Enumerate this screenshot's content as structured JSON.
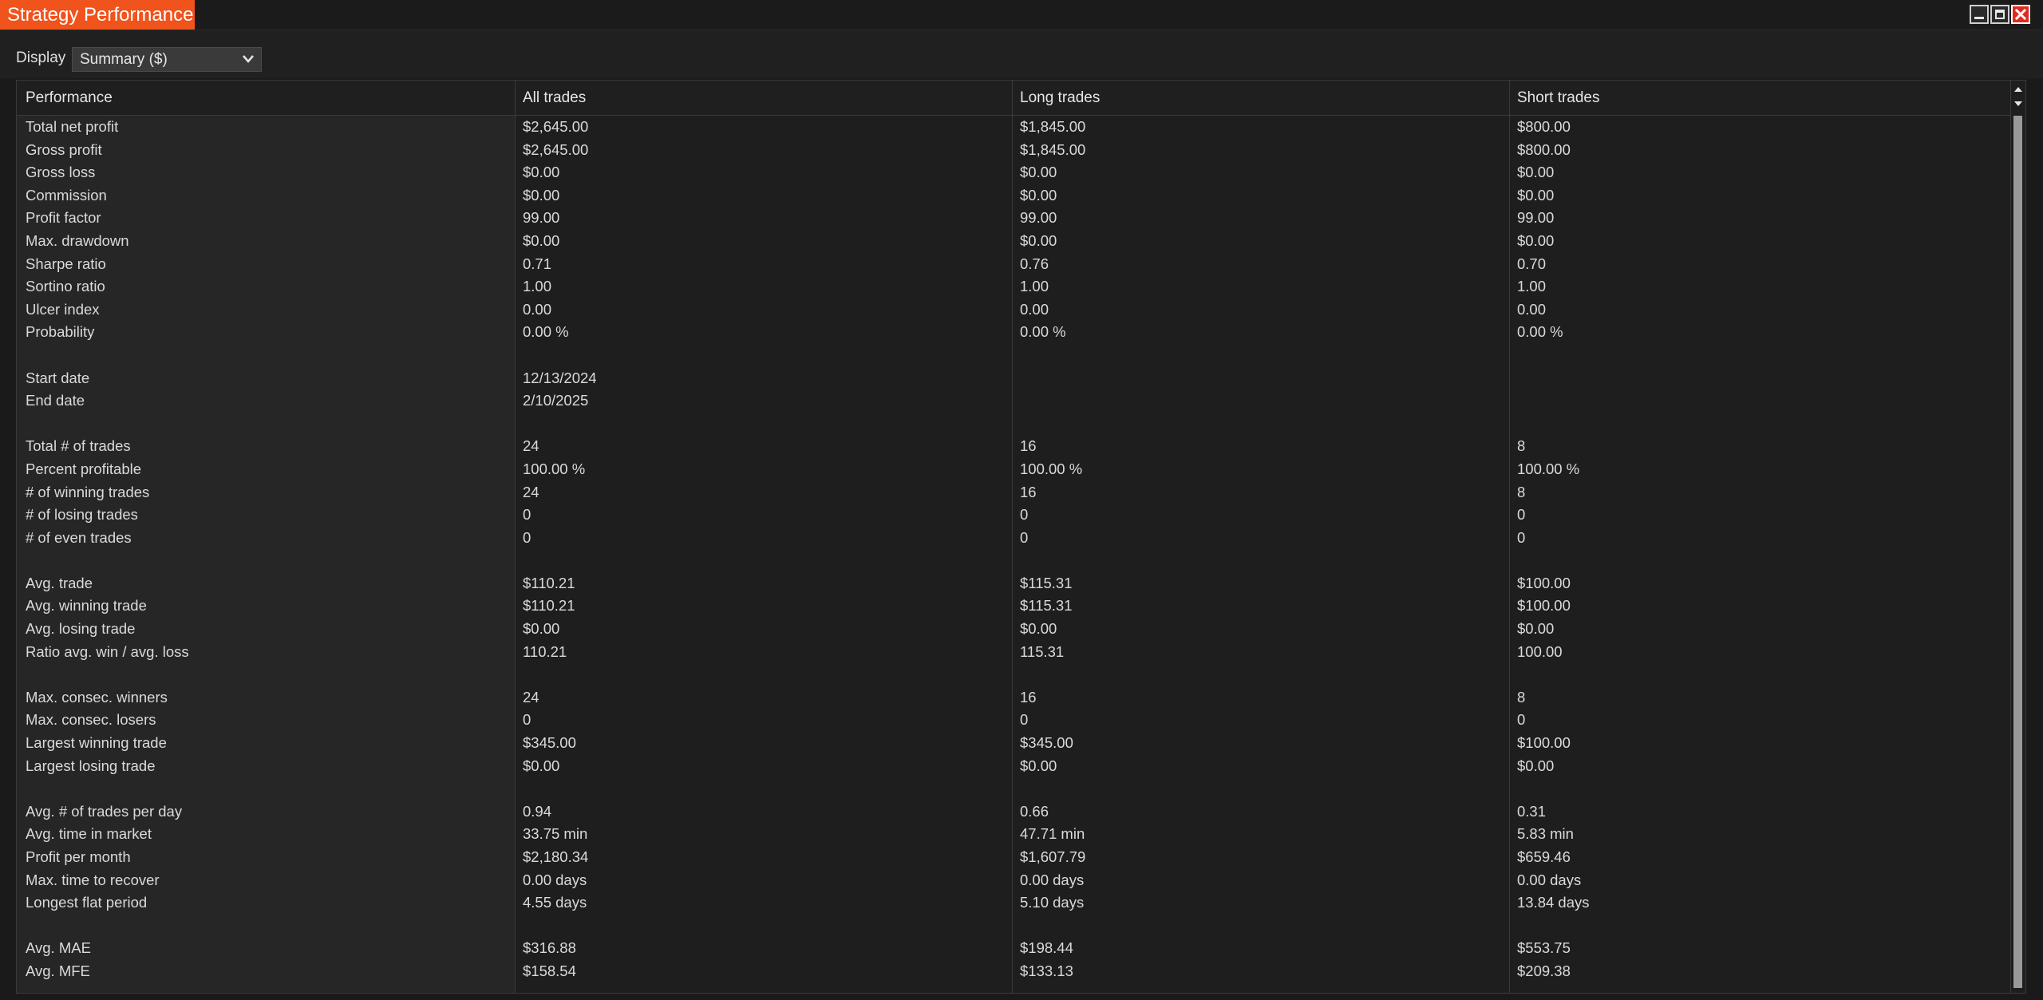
{
  "window": {
    "title": "Strategy Performance",
    "accent_color": "#f0531c",
    "close_color": "#e02b1e"
  },
  "toolbar": {
    "display_label": "Display",
    "display_value": "Summary ($)"
  },
  "table": {
    "headers": [
      "Performance",
      "All trades",
      "Long trades",
      "Short trades"
    ],
    "rows": [
      [
        "Total net profit",
        "$2,645.00",
        "$1,845.00",
        "$800.00"
      ],
      [
        "Gross profit",
        "$2,645.00",
        "$1,845.00",
        "$800.00"
      ],
      [
        "Gross loss",
        "$0.00",
        "$0.00",
        "$0.00"
      ],
      [
        "Commission",
        "$0.00",
        "$0.00",
        "$0.00"
      ],
      [
        "Profit factor",
        "99.00",
        "99.00",
        "99.00"
      ],
      [
        "Max. drawdown",
        "$0.00",
        "$0.00",
        "$0.00"
      ],
      [
        "Sharpe ratio",
        "0.71",
        "0.76",
        "0.70"
      ],
      [
        "Sortino ratio",
        "1.00",
        "1.00",
        "1.00"
      ],
      [
        "Ulcer index",
        "0.00",
        "0.00",
        "0.00"
      ],
      [
        "Probability",
        "0.00 %",
        "0.00 %",
        "0.00 %"
      ],
      [
        "",
        "",
        "",
        ""
      ],
      [
        "Start date",
        "12/13/2024",
        "",
        ""
      ],
      [
        "End date",
        "2/10/2025",
        "",
        ""
      ],
      [
        "",
        "",
        "",
        ""
      ],
      [
        "Total # of trades",
        "24",
        "16",
        "8"
      ],
      [
        "Percent profitable",
        "100.00 %",
        "100.00 %",
        "100.00 %"
      ],
      [
        "# of winning trades",
        "24",
        "16",
        "8"
      ],
      [
        "# of losing trades",
        "0",
        "0",
        "0"
      ],
      [
        "# of even trades",
        "0",
        "0",
        "0"
      ],
      [
        "",
        "",
        "",
        ""
      ],
      [
        "Avg. trade",
        "$110.21",
        "$115.31",
        "$100.00"
      ],
      [
        "Avg. winning trade",
        "$110.21",
        "$115.31",
        "$100.00"
      ],
      [
        "Avg. losing trade",
        "$0.00",
        "$0.00",
        "$0.00"
      ],
      [
        "Ratio avg. win / avg. loss",
        "110.21",
        "115.31",
        "100.00"
      ],
      [
        "",
        "",
        "",
        ""
      ],
      [
        "Max. consec. winners",
        "24",
        "16",
        "8"
      ],
      [
        "Max. consec. losers",
        "0",
        "0",
        "0"
      ],
      [
        "Largest winning trade",
        "$345.00",
        "$345.00",
        "$100.00"
      ],
      [
        "Largest losing trade",
        "$0.00",
        "$0.00",
        "$0.00"
      ],
      [
        "",
        "",
        "",
        ""
      ],
      [
        "Avg. # of trades per day",
        "0.94",
        "0.66",
        "0.31"
      ],
      [
        "Avg. time in market",
        "33.75 min",
        "47.71 min",
        "5.83 min"
      ],
      [
        "Profit per month",
        "$2,180.34",
        "$1,607.79",
        "$659.46"
      ],
      [
        "Max. time to recover",
        "0.00 days",
        "0.00 days",
        "0.00 days"
      ],
      [
        "Longest flat period",
        "4.55 days",
        "5.10 days",
        "13.84 days"
      ],
      [
        "",
        "",
        "",
        ""
      ],
      [
        "Avg. MAE",
        "$316.88",
        "$198.44",
        "$553.75"
      ],
      [
        "Avg. MFE",
        "$158.54",
        "$133.13",
        "$209.38"
      ]
    ]
  }
}
